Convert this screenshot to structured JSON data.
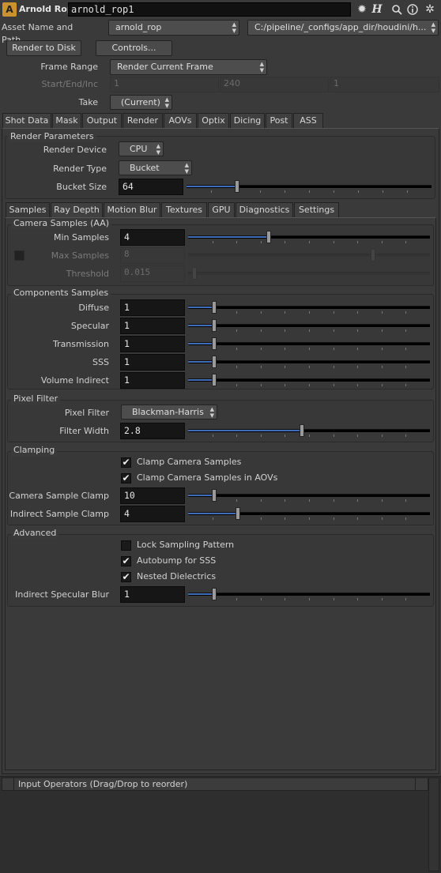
{
  "header": {
    "node_type": "Arnold Rop",
    "node_name": "arnold_rop1",
    "app_icon": "A",
    "icons": [
      "gear-icon",
      "help-icon",
      "search-icon",
      "info-icon",
      "settings-icon"
    ]
  },
  "asset": {
    "label": "Asset Name and Path",
    "name": "arnold_rop",
    "path": "C:/pipeline/_configs/app_dir/houdini/h..."
  },
  "toolbar": {
    "render_to_disk": "Render to Disk",
    "controls": "Controls..."
  },
  "frame_range": {
    "label": "Frame Range",
    "value": "Render Current Frame",
    "start_end_label": "Start/End/Inc",
    "start": "1",
    "end": "240",
    "inc": "1",
    "take_label": "Take",
    "take_value": "(Current)"
  },
  "main_tabs": [
    "Shot Data",
    "Mask",
    "Output",
    "Render",
    "AOVs",
    "Optix",
    "Dicing",
    "Post",
    "ASS"
  ],
  "active_main_tab": "Render",
  "render_params": {
    "title": "Render Parameters",
    "device_label": "Render Device",
    "device_value": "CPU",
    "type_label": "Render Type",
    "type_value": "Bucket",
    "bucket_label": "Bucket Size",
    "bucket_value": "64",
    "bucket_fraction": 0.2
  },
  "sub_tabs": [
    "Samples",
    "Ray Depth",
    "Motion Blur",
    "Textures",
    "GPU",
    "Diagnostics",
    "Settings"
  ],
  "active_sub_tab": "Samples",
  "camera_samples": {
    "title": "Camera Samples (AA)",
    "min_label": "Min Samples",
    "min_value": "4",
    "min_fraction": 0.33,
    "max_label": "Max Samples",
    "max_value": "8",
    "max_fraction": 0.77,
    "threshold_label": "Threshold",
    "threshold_value": "0.015",
    "threshold_fraction": 0.015
  },
  "components": {
    "title": "Components Samples",
    "rows": [
      {
        "label": "Diffuse",
        "value": "1",
        "fraction": 0.1
      },
      {
        "label": "Specular",
        "value": "1",
        "fraction": 0.1
      },
      {
        "label": "Transmission",
        "value": "1",
        "fraction": 0.1
      },
      {
        "label": "SSS",
        "value": "1",
        "fraction": 0.1
      },
      {
        "label": "Volume Indirect",
        "value": "1",
        "fraction": 0.1
      }
    ]
  },
  "pixel_filter": {
    "title": "Pixel Filter",
    "filter_label": "Pixel Filter",
    "filter_value": "Blackman-Harris",
    "width_label": "Filter Width",
    "width_value": "2.8",
    "width_fraction": 0.47
  },
  "clamping": {
    "title": "Clamping",
    "clamp_camera": "Clamp Camera Samples",
    "clamp_camera_aovs": "Clamp Camera Samples in AOVs",
    "camera_clamp_label": "Camera Sample Clamp",
    "camera_clamp_value": "10",
    "camera_clamp_fraction": 0.1,
    "indirect_clamp_label": "Indirect Sample Clamp",
    "indirect_clamp_value": "4",
    "indirect_clamp_fraction": 0.2
  },
  "advanced": {
    "title": "Advanced",
    "lock_pattern": "Lock Sampling Pattern",
    "autobump": "Autobump for SSS",
    "nested": "Nested Dielectrics",
    "blur_label": "Indirect Specular Blur",
    "blur_value": "1",
    "blur_fraction": 0.1
  },
  "input_operators": {
    "header": "Input Operators (Drag/Drop to reorder)"
  }
}
